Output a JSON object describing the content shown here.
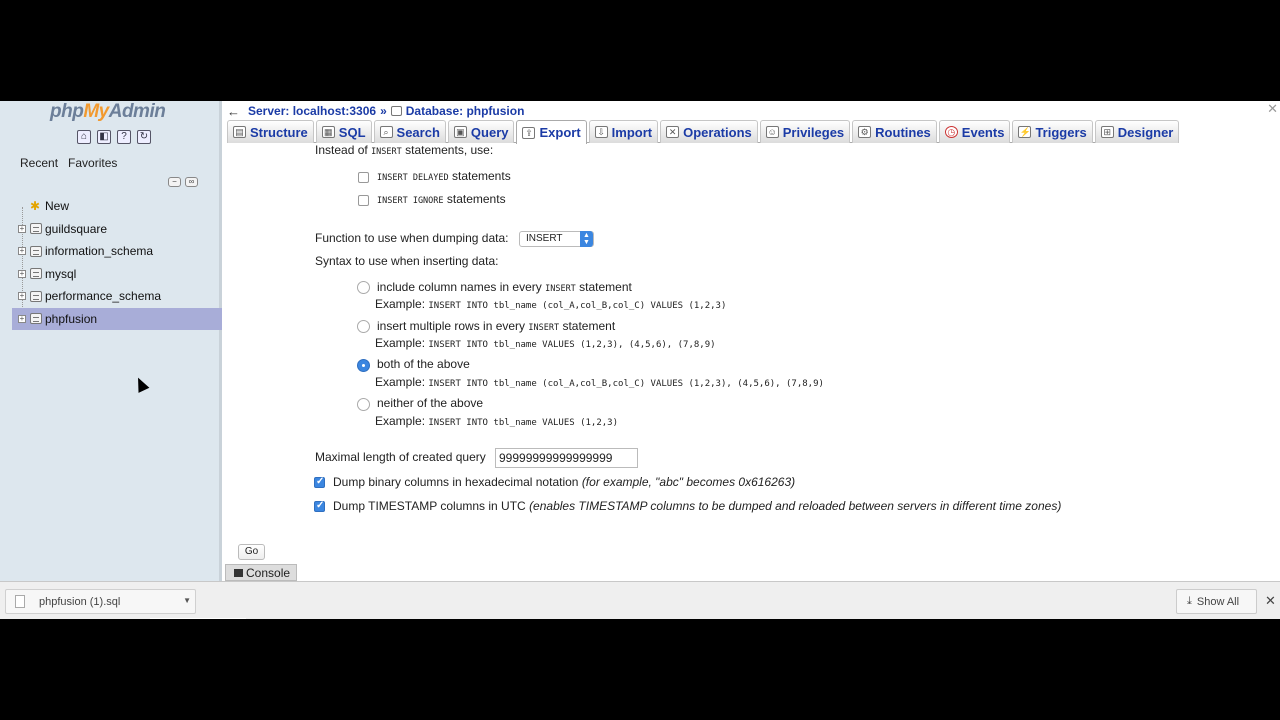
{
  "sidebar": {
    "logo_php": "php",
    "logo_my": "My",
    "logo_admin": "Admin",
    "tabs": [
      "Recent",
      "Favorites"
    ],
    "tree": [
      {
        "label": "New",
        "kind": "new"
      },
      {
        "label": "guildsquare",
        "kind": "db"
      },
      {
        "label": "information_schema",
        "kind": "db"
      },
      {
        "label": "mysql",
        "kind": "db"
      },
      {
        "label": "performance_schema",
        "kind": "db"
      },
      {
        "label": "phpfusion",
        "kind": "db",
        "selected": true
      }
    ]
  },
  "breadcrumb": {
    "server": "Server: localhost:3306",
    "separator": "»",
    "database": "Database: phpfusion"
  },
  "tabs": [
    {
      "label": "Structure",
      "icon": "structure-icon"
    },
    {
      "label": "SQL",
      "icon": "sql-icon"
    },
    {
      "label": "Search",
      "icon": "search-icon"
    },
    {
      "label": "Query",
      "icon": "query-icon"
    },
    {
      "label": "Export",
      "icon": "export-icon",
      "active": true
    },
    {
      "label": "Import",
      "icon": "import-icon"
    },
    {
      "label": "Operations",
      "icon": "operations-icon"
    },
    {
      "label": "Privileges",
      "icon": "privileges-icon"
    },
    {
      "label": "Routines",
      "icon": "routines-icon"
    },
    {
      "label": "Events",
      "icon": "events-icon"
    },
    {
      "label": "Triggers",
      "icon": "triggers-icon"
    },
    {
      "label": "Designer",
      "icon": "designer-icon"
    }
  ],
  "form": {
    "instead_prefix": "Instead of",
    "instead_kw": "insert",
    "instead_suffix": "statements, use:",
    "opt_delayed_kw": "insert delayed",
    "opt_delayed_label": "statements",
    "opt_ignore_kw": "insert ignore",
    "opt_ignore_label": "statements",
    "function_label": "Function to use when dumping data:",
    "function_value": "INSERT",
    "syntax_label": "Syntax to use when inserting data:",
    "syntax_options": [
      {
        "pre": "include column names in every",
        "kw": "insert",
        "post": "statement",
        "example_label": "Example:",
        "example": "INSERT INTO tbl_name (col_A,col_B,col_C) VALUES (1,2,3)",
        "checked": false
      },
      {
        "pre": "insert multiple rows in every",
        "kw": "insert",
        "post": "statement",
        "example_label": "Example:",
        "example": "INSERT INTO tbl_name VALUES (1,2,3), (4,5,6), (7,8,9)",
        "checked": false
      },
      {
        "pre": "both of the above",
        "kw": "",
        "post": "",
        "example_label": "Example:",
        "example": "INSERT INTO tbl_name (col_A,col_B,col_C) VALUES (1,2,3), (4,5,6), (7,8,9)",
        "checked": true
      },
      {
        "pre": "neither of the above",
        "kw": "",
        "post": "",
        "example_label": "Example:",
        "example": "INSERT INTO tbl_name VALUES (1,2,3)",
        "checked": false
      }
    ],
    "maxlen_label": "Maximal length of created query",
    "maxlen_value": "99999999999999999",
    "hex_label": "Dump binary columns in hexadecimal notation",
    "hex_note": "(for example, \"abc\" becomes 0x616263)",
    "utc_label": "Dump TIMESTAMP columns in UTC",
    "utc_note": "(enables TIMESTAMP columns to be dumped and reloaded between servers in different time zones)",
    "go_label": "Go",
    "console_label": "Console"
  },
  "downloads": {
    "file": "phpfusion (1).sql",
    "show_all": "Show All"
  }
}
